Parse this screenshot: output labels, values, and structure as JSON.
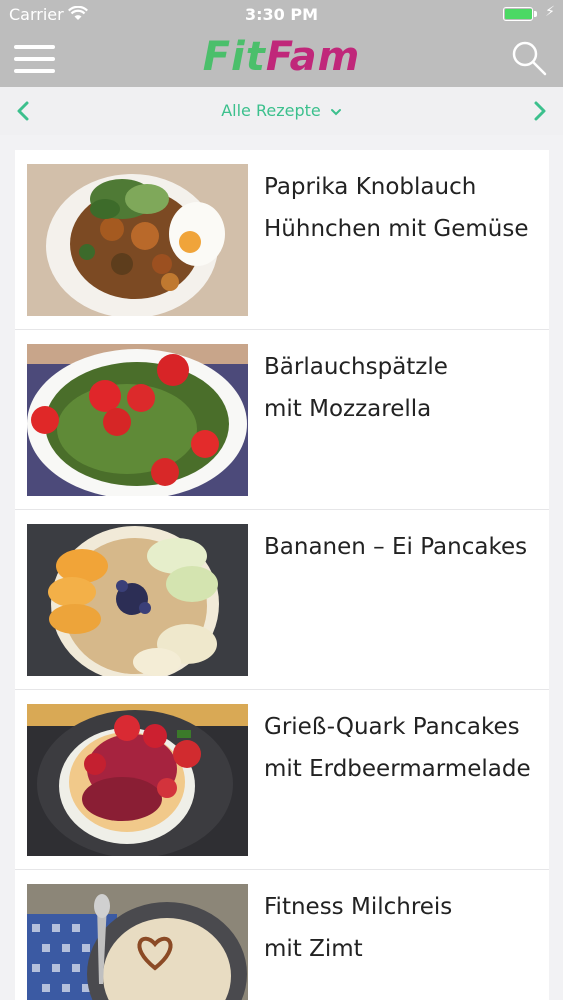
{
  "statusbar": {
    "carrier": "Carrier",
    "time": "3:30 PM",
    "battery_level": 0.95
  },
  "navbar": {
    "logo_fit": "Fit",
    "logo_fam": "Fam",
    "menu_icon": "hamburger-menu-icon",
    "search_icon": "search-icon"
  },
  "subnav": {
    "title": "Alle Rezepte",
    "prev_icon": "chevron-left-icon",
    "next_icon": "chevron-right-icon"
  },
  "colors": {
    "accent": "#3cc08d",
    "logo_green": "#4bbf6b",
    "logo_magenta": "#c0277a",
    "bar_gray": "#bdbdbd"
  },
  "recipes": [
    {
      "line1": "Paprika Knoblauch",
      "line2": "Hühnchen mit Gemüse"
    },
    {
      "line1": "Bärlauchspätzle",
      "line2": "mit Mozzarella"
    },
    {
      "line1": "Bananen – Ei Pancakes",
      "line2": ""
    },
    {
      "line1": "Grieß-Quark Pancakes",
      "line2": "mit Erdbeermarmelade"
    },
    {
      "line1": "Fitness Milchreis",
      "line2": "mit Zimt"
    }
  ]
}
